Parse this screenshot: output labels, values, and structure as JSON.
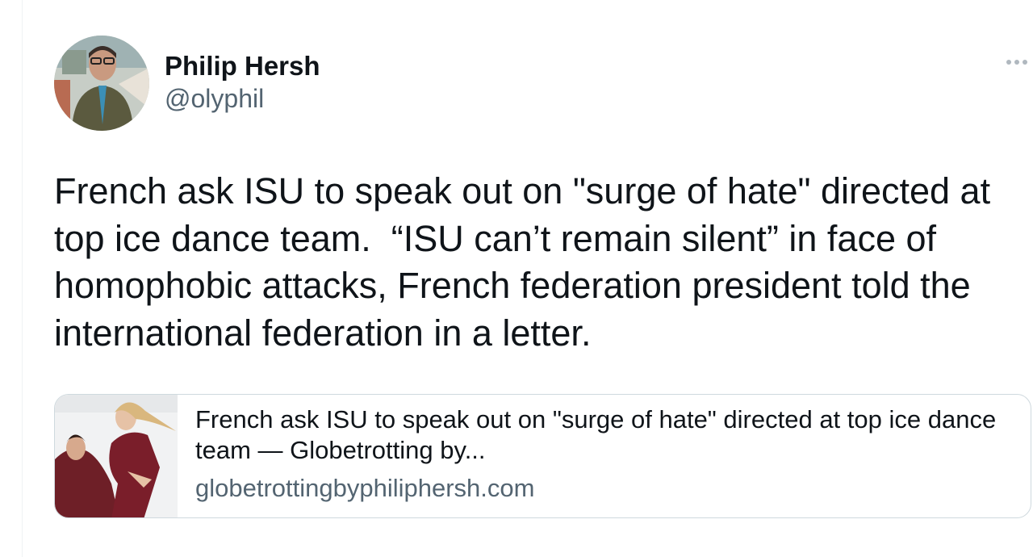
{
  "author": {
    "display_name": "Philip Hersh",
    "handle": "@olyphil"
  },
  "tweet": {
    "text": "French ask ISU to speak out on \"surge of hate\" directed at\ntop ice dance team.  “ISU can’t remain silent” in face of\nhomophobic attacks, French federation president told the\ninternational federation in a letter."
  },
  "link_card": {
    "title": "French ask ISU to speak out on \"surge of hate\" directed at top ice dance team — Globetrotting by...",
    "domain": "globetrottingbyphiliphersh.com"
  },
  "icons": {
    "more": "more-horizontal-icon"
  },
  "colors": {
    "text_primary": "#0f1419",
    "text_secondary": "#536471",
    "border": "#cfd9de"
  }
}
